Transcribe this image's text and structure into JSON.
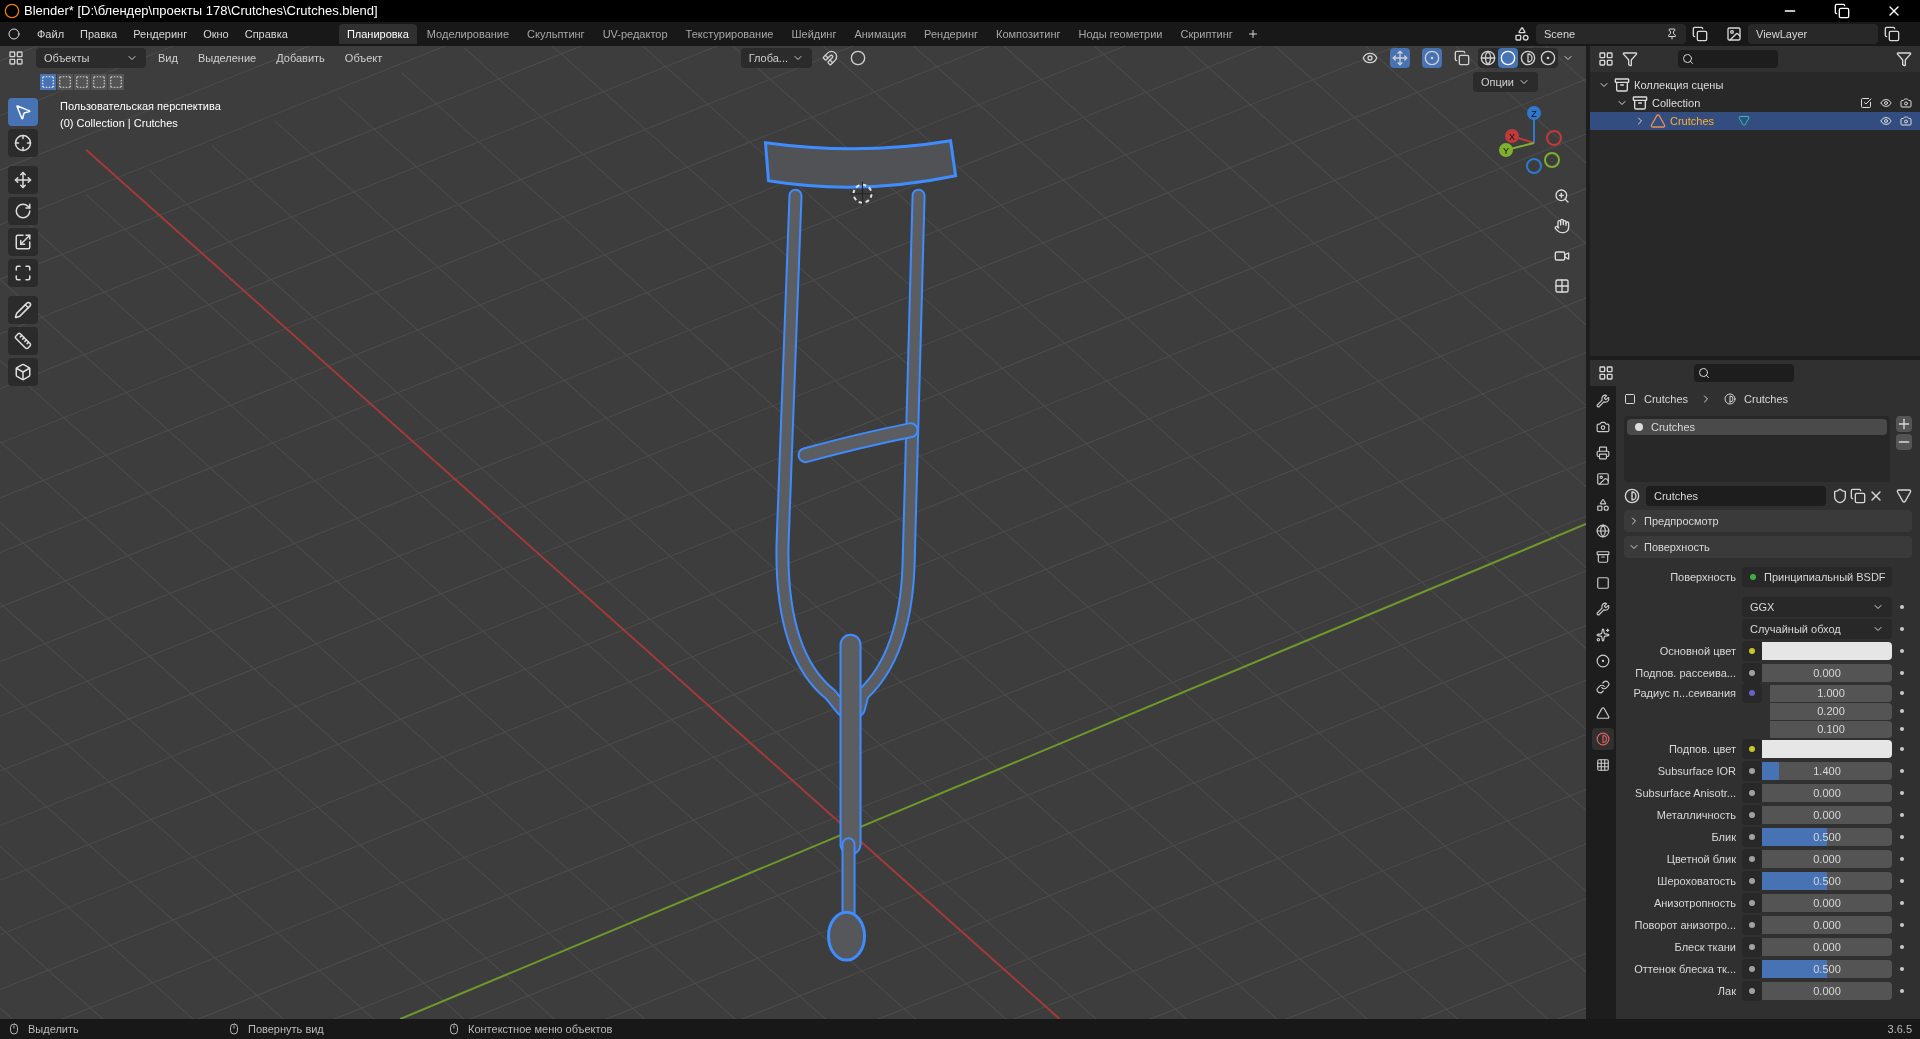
{
  "window": {
    "title": "Blender* [D:\\блендер\\проекты 178\\Crutches\\Crutches.blend]"
  },
  "menu": [
    "Файл",
    "Правка",
    "Рендеринг",
    "Окно",
    "Справка"
  ],
  "workspaces": [
    {
      "label": "Планировка",
      "selected": true
    },
    {
      "label": "Моделирование",
      "selected": false
    },
    {
      "label": "Скульптинг",
      "selected": false
    },
    {
      "label": "UV-редактор",
      "selected": false
    },
    {
      "label": "Текстурирование",
      "selected": false
    },
    {
      "label": "Шейдинг",
      "selected": false
    },
    {
      "label": "Анимация",
      "selected": false
    },
    {
      "label": "Рендеринг",
      "selected": false
    },
    {
      "label": "Композитинг",
      "selected": false
    },
    {
      "label": "Ноды геометрии",
      "selected": false
    },
    {
      "label": "Скриптинг",
      "selected": false
    }
  ],
  "scene": {
    "name": "Scene",
    "view_layer": "ViewLayer"
  },
  "viewport": {
    "mode": "Объекты",
    "menus": [
      "Вид",
      "Выделение",
      "Добавить",
      "Объект"
    ],
    "orientation": "Глоба...",
    "options": "Опции",
    "select_modes": [
      {
        "selected": true
      },
      {
        "selected": false
      },
      {
        "selected": false
      },
      {
        "selected": false
      },
      {
        "selected": false
      }
    ],
    "shading": [
      {
        "kind": "wireframe",
        "selected": false
      },
      {
        "kind": "solid",
        "selected": true
      },
      {
        "kind": "material",
        "selected": false
      },
      {
        "kind": "rendered",
        "selected": false
      }
    ],
    "overlay_text": [
      "Пользовательская перспектива",
      "(0) Collection | Crutches"
    ],
    "tools": [
      {
        "kind": "select",
        "selected": true
      },
      {
        "kind": "cursor",
        "selected": false
      },
      {
        "kind": "move",
        "selected": false
      },
      {
        "kind": "rotate",
        "selected": false
      },
      {
        "kind": "scale",
        "selected": false
      },
      {
        "kind": "transform",
        "selected": false
      },
      {
        "kind": "annotate",
        "selected": false
      },
      {
        "kind": "measure",
        "selected": false
      },
      {
        "kind": "add-cube",
        "selected": false
      }
    ],
    "gizmo": {
      "axes": [
        "X",
        "Y",
        "Z"
      ]
    }
  },
  "outliner": {
    "tree": [
      {
        "label": "Коллекция сцены",
        "kind": "scene",
        "expanded": true,
        "selected": false,
        "children": [
          {
            "label": "Collection",
            "kind": "collection",
            "expanded": true,
            "selected": false,
            "children": [
              {
                "label": "Crutches",
                "kind": "object",
                "expanded": false,
                "selected": true
              }
            ]
          }
        ]
      }
    ]
  },
  "properties": {
    "tabs": [
      {
        "kind": "tool",
        "selected": false
      },
      {
        "kind": "render",
        "selected": false
      },
      {
        "kind": "output",
        "selected": false
      },
      {
        "kind": "view-layer",
        "selected": false
      },
      {
        "kind": "scene",
        "selected": false
      },
      {
        "kind": "world",
        "selected": false
      },
      {
        "kind": "collection",
        "selected": false
      },
      {
        "kind": "object",
        "selected": false
      },
      {
        "kind": "modifiers",
        "selected": false
      },
      {
        "kind": "particles",
        "selected": false
      },
      {
        "kind": "physics",
        "selected": false
      },
      {
        "kind": "constraints",
        "selected": false
      },
      {
        "kind": "data",
        "selected": false
      },
      {
        "kind": "material",
        "selected": true
      },
      {
        "kind": "texture",
        "selected": false
      }
    ],
    "breadcrumb": [
      "Crutches",
      "Crutches"
    ],
    "slots": [
      {
        "label": "Crutches",
        "selected": true
      }
    ],
    "material": "Crutches",
    "panels": [
      {
        "title": "Предпросмотр",
        "expanded": false
      },
      {
        "title": "Поверхность",
        "expanded": true
      }
    ],
    "rows": [
      {
        "kind": "shader",
        "label": "Поверхность",
        "value": "Принципиальный BSDF"
      },
      {
        "kind": "dropdown",
        "value": "GGX"
      },
      {
        "kind": "dropdown",
        "value": "Случайный обход"
      },
      {
        "kind": "swatch",
        "label": "Основной цвет",
        "color": "#e6e6e6"
      },
      {
        "kind": "number",
        "label": "Подпов. рассеива...",
        "value": "0.000",
        "level": 0
      },
      {
        "kind": "vector",
        "label": "Радиус п...сеивания",
        "values": [
          "1.000",
          "0.200",
          "0.100"
        ]
      },
      {
        "kind": "swatch",
        "label": "Подпов. цвет",
        "color": "#e6e6e6"
      },
      {
        "kind": "number",
        "label": "Subsurface IOR",
        "value": "1.400",
        "level": 0.13
      },
      {
        "kind": "number",
        "label": "Subsurface Anisotr...",
        "value": "0.000",
        "level": 0
      },
      {
        "kind": "number",
        "label": "Металличность",
        "value": "0.000",
        "level": 0
      },
      {
        "kind": "number",
        "label": "Блик",
        "value": "0.500",
        "level": 0.5
      },
      {
        "kind": "number",
        "label": "Цветной блик",
        "value": "0.000",
        "level": 0
      },
      {
        "kind": "number",
        "label": "Шероховатость",
        "value": "0.500",
        "level": 0.5
      },
      {
        "kind": "number",
        "label": "Анизотропность",
        "value": "0.000",
        "level": 0
      },
      {
        "kind": "number",
        "label": "Поворот анизотро...",
        "value": "0.000",
        "level": 0
      },
      {
        "kind": "number",
        "label": "Блеск ткани",
        "value": "0.000",
        "level": 0
      },
      {
        "kind": "number",
        "label": "Оттенок блеска тк...",
        "value": "0.500",
        "level": 0.5
      },
      {
        "kind": "number",
        "label": "Лак",
        "value": "0.000",
        "level": 0
      }
    ]
  },
  "status_bar": {
    "hints": [
      "Выделить",
      "Повернуть вид",
      "Контекстное меню объектов"
    ],
    "version": "3.6.5"
  }
}
